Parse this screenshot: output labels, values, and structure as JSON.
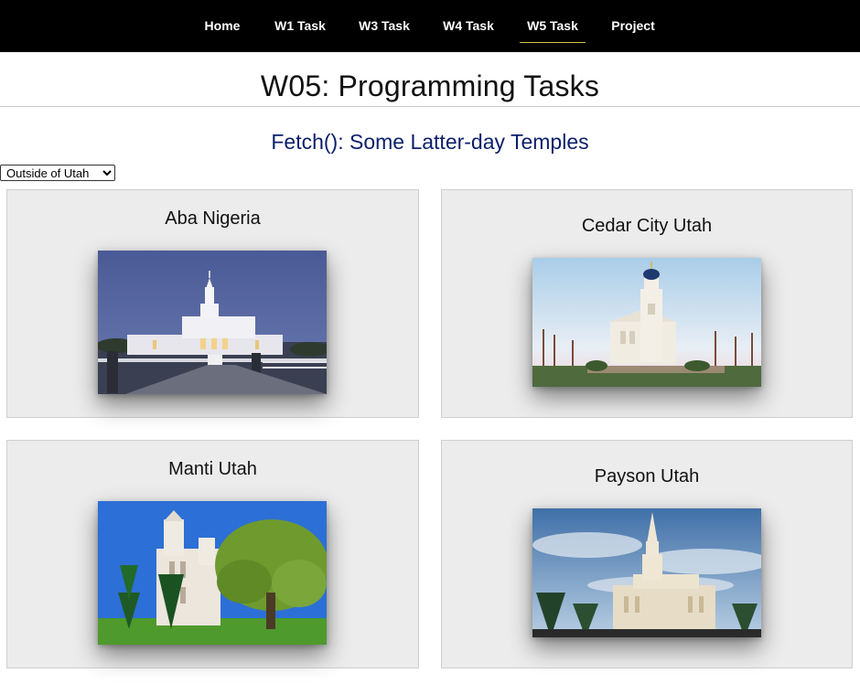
{
  "nav": {
    "items": [
      {
        "label": "Home"
      },
      {
        "label": "W1 Task"
      },
      {
        "label": "W3 Task"
      },
      {
        "label": "W4 Task"
      },
      {
        "label": "W5 Task",
        "active": true
      },
      {
        "label": "Project"
      }
    ],
    "active_underline_color": "#d8c64a"
  },
  "page": {
    "title": "W05: Programming Tasks",
    "section_title": "Fetch(): Some Latter-day Temples",
    "section_title_color": "#0b1f6b"
  },
  "filter": {
    "selected": "Outside of Utah",
    "options": [
      "Outside of Utah"
    ]
  },
  "temples": [
    {
      "name": "Aba Nigeria",
      "photo_icon": "temple-photo-aba-nigeria"
    },
    {
      "name": "Cedar City Utah",
      "photo_icon": "temple-photo-cedar-city"
    },
    {
      "name": "Manti Utah",
      "photo_icon": "temple-photo-manti"
    },
    {
      "name": "Payson Utah",
      "photo_icon": "temple-photo-payson"
    }
  ]
}
